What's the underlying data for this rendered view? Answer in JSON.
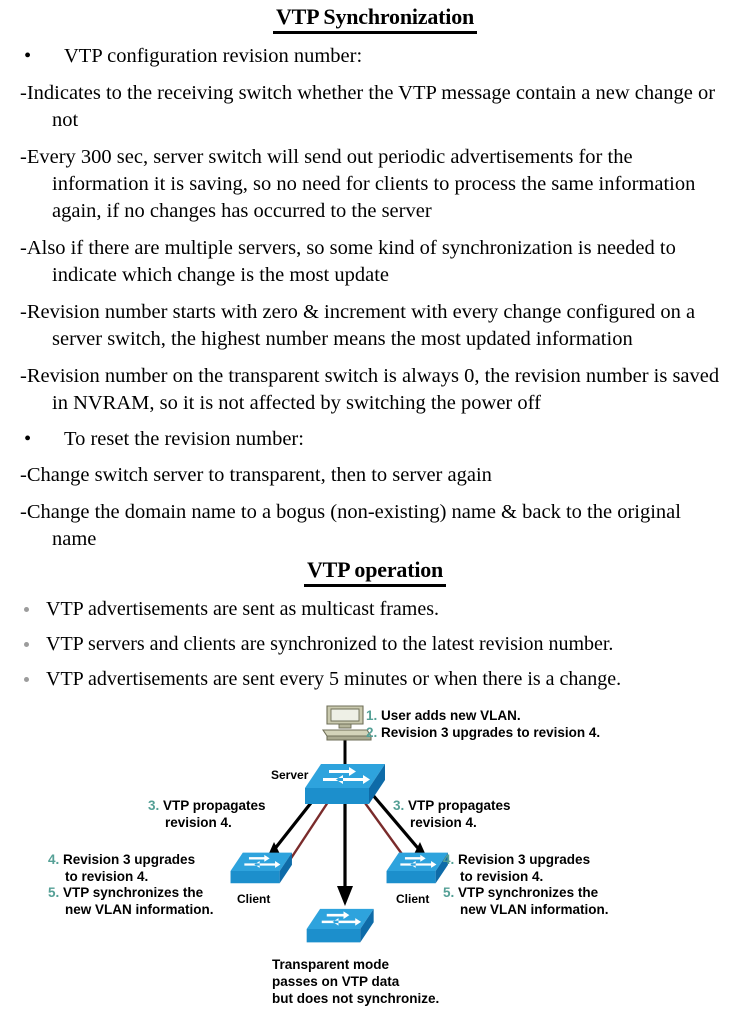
{
  "document": {
    "heading_main": "VTP Synchronization",
    "heading_operation": "VTP operation"
  },
  "section_sync": {
    "bullet1": "VTP configuration revision number:",
    "para1": "-Indicates to the receiving switch whether the VTP message contain a new change or not",
    "para2": "-Every 300 sec, server switch will send out periodic advertisements for the information it is saving, so no need for clients to process the same information again, if no changes has occurred to the server",
    "para3": "-Also if there are multiple servers, so some kind of synchronization is needed to indicate which change is the most update",
    "para4": "-Revision number starts with zero & increment with every change configured on a server switch, the highest number means the most updated information",
    "para5": "-Revision number on the transparent switch is always 0, the revision number is saved in NVRAM, so it is not affected by switching the power off",
    "bullet2": "To reset the revision number:",
    "para6": "-Change switch server to transparent, then to server again",
    "para7": "-Change the domain name to a bogus (non-existing) name & back to the original name",
    "bullet_glyph": "•"
  },
  "section_operation": {
    "bullets": [
      "VTP advertisements are sent as multicast frames.",
      "VTP servers and clients are synchronized to the latest revision number.",
      "VTP advertisements are sent every 5 minutes or when there is a change."
    ]
  },
  "diagram": {
    "notes_top": {
      "step1_num": "1.",
      "step1_text": "User adds new VLAN.",
      "step2_num": "2.",
      "step2_text": "Revision 3 upgrades to revision 4."
    },
    "note_left_prop": {
      "num": "3.",
      "line1": "VTP propagates",
      "line2": "revision 4."
    },
    "note_right_prop": {
      "num": "3.",
      "line1": "VTP propagates",
      "line2": "revision 4."
    },
    "note_left_client": {
      "num4": "4.",
      "line1": "Revision 3 upgrades",
      "line2": "to revision 4.",
      "num5": "5.",
      "line3": "VTP synchronizes the",
      "line4": "new VLAN information."
    },
    "note_right_client": {
      "num4": "4.",
      "line1": "Revision 3 upgrades",
      "line2": "to revision 4.",
      "num5": "5.",
      "line3": "VTP synchronizes the",
      "line4": "new VLAN information."
    },
    "labels": {
      "server": "Server",
      "client_left": "Client",
      "client_right": "Client"
    },
    "caption_transparent": {
      "line1": "Transparent mode",
      "line2": "passes on VTP data",
      "line3": "but does not synchronize."
    },
    "colors": {
      "step_number": "#55a096",
      "switch_top": "#2ea3dd",
      "switch_front": "#1071b8",
      "switch_side": "#0e5f9e",
      "switch_arrow": "#ffffff",
      "pc_body": "#c9c9ae",
      "pc_shade": "#9a9a80",
      "link_line": "#7a2b2b",
      "arrow_black": "#000000",
      "bullet_gray": "#9c9c9c"
    }
  }
}
